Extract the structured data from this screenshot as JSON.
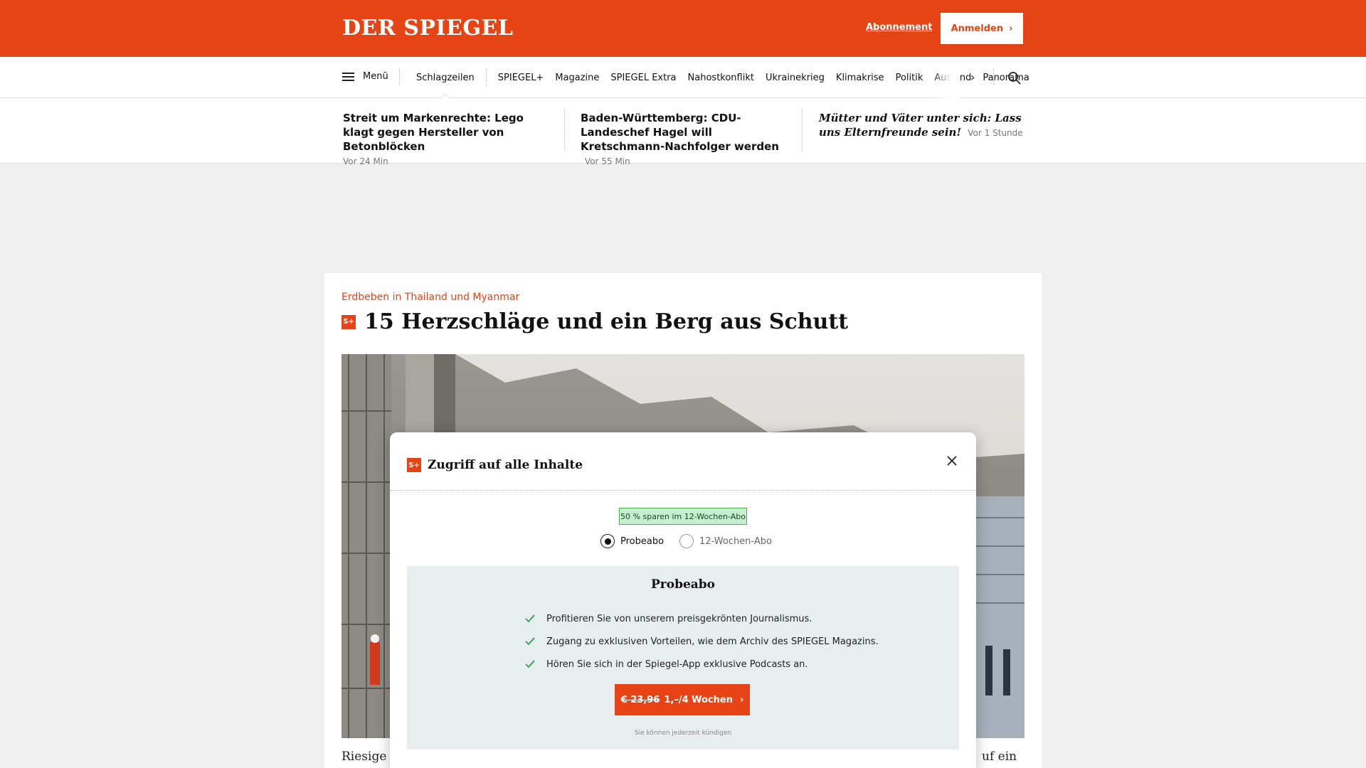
{
  "header": {
    "logo": "DER SPIEGEL",
    "abo_link": "Abonnement",
    "login_label": "Anmelden",
    "login_chevron": "›",
    "brand_color": "#e64415"
  },
  "nav": {
    "menu_label": "Menü",
    "items": [
      "Schlagzeilen",
      "SPIEGEL+",
      "Magazine",
      "SPIEGEL Extra",
      "Nahostkonflikt",
      "Ukrainekrieg",
      "Klimakrise",
      "Politik",
      "Ausland",
      "Panorama"
    ],
    "more_icon": "›",
    "search_icon": "search-icon"
  },
  "headlines": [
    {
      "text": "Streit um Markenrechte: Lego klagt gegen Hersteller von Betonblöcken",
      "time": "Vor 24 Min"
    },
    {
      "text": "Baden-Württemberg: CDU-Landeschef Hagel will Kretschmann-Nachfolger werden",
      "time": "Vor 55 Min"
    },
    {
      "text": "Mütter und Väter unter sich: Lass uns Elternfreunde sein!",
      "time": "Vor 1 Stunde"
    }
  ],
  "article": {
    "kicker": "Erdbeben in Thailand und Myanmar",
    "badge": "S+",
    "title": "15 Herzschläge und ein Berg aus Schutt",
    "teaser_left": "Riesige V",
    "teaser_right": "uf ein"
  },
  "modal": {
    "badge": "S+",
    "title": "Zugriff auf alle Inhalte",
    "save_badge": "50 % sparen im 12-Wochen-Abo",
    "radio_options": [
      "Probeabo",
      "12-Wochen-Abo"
    ],
    "selected_option": "Probeabo",
    "offer_title": "Probeabo",
    "benefits": [
      "Profitieren Sie von unserem preisgekrönten Journalismus.",
      "Zugang zu exklusiven Vorteilen, wie dem Archiv des SPIEGEL Magazins.",
      "Hören Sie sich in der Spiegel-App exklusive Podcasts an."
    ],
    "cta_old_price": "€ 23,96",
    "cta_new_price": "1,–/4 Wochen",
    "cta_chevron": "›",
    "cancel_note": "Sie können jederzeit kündigen"
  }
}
